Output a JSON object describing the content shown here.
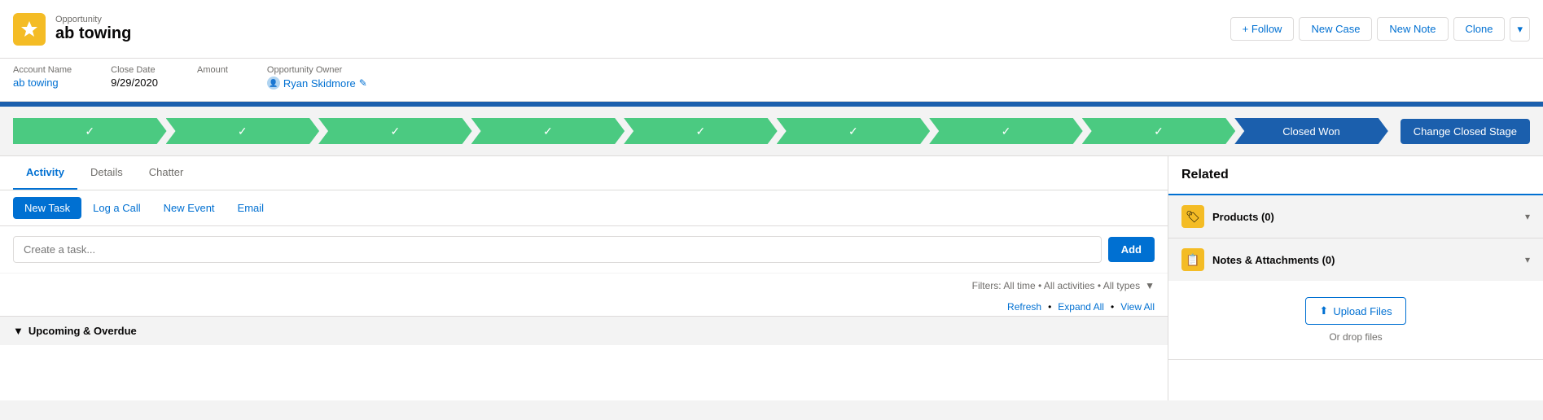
{
  "header": {
    "object_type": "Opportunity",
    "object_name": "ab towing",
    "buttons": {
      "follow": "+ Follow",
      "new_case": "New Case",
      "new_note": "New Note",
      "clone": "Clone"
    }
  },
  "meta": {
    "account_name_label": "Account Name",
    "account_name_value": "ab towing",
    "close_date_label": "Close Date",
    "close_date_value": "9/29/2020",
    "amount_label": "Amount",
    "amount_value": "",
    "owner_label": "Opportunity Owner",
    "owner_value": "Ryan Skidmore"
  },
  "stages": {
    "completed": [
      "✓",
      "✓",
      "✓",
      "✓",
      "✓",
      "✓",
      "✓",
      "✓"
    ],
    "active": "Closed Won",
    "change_button": "Change Closed Stage"
  },
  "tabs": {
    "items": [
      {
        "label": "Activity",
        "active": true
      },
      {
        "label": "Details",
        "active": false
      },
      {
        "label": "Chatter",
        "active": false
      }
    ]
  },
  "sub_tabs": {
    "items": [
      {
        "label": "New Task",
        "active": true
      },
      {
        "label": "Log a Call",
        "active": false
      },
      {
        "label": "New Event",
        "active": false
      },
      {
        "label": "Email",
        "active": false
      }
    ]
  },
  "task_input": {
    "placeholder": "Create a task...",
    "add_button": "Add"
  },
  "filters": {
    "text": "Filters: All time • All activities • All types"
  },
  "filter_links": {
    "refresh": "Refresh",
    "expand_all": "Expand All",
    "view_all": "View All"
  },
  "upcoming": {
    "label": "Upcoming & Overdue"
  },
  "related": {
    "title": "Related",
    "products": {
      "label": "Products (0)"
    },
    "notes": {
      "label": "Notes & Attachments (0)",
      "upload_button": "Upload Files",
      "drop_text": "Or drop files"
    }
  }
}
